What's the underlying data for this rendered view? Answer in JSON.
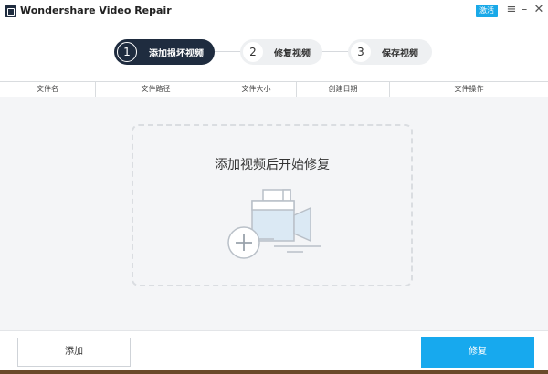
{
  "window": {
    "title": "Wondershare Video Repair",
    "activate_label": "激活",
    "icons": [
      "menu-icon",
      "minimize-icon",
      "close-icon"
    ]
  },
  "steps": [
    {
      "number": "1",
      "label": "添加损坏视频",
      "active": true
    },
    {
      "number": "2",
      "label": "修复视频",
      "active": false
    },
    {
      "number": "3",
      "label": "保存视频",
      "active": false
    }
  ],
  "table": {
    "columns": [
      "文件名",
      "文件路径",
      "文件大小",
      "创建日期",
      "文件操作"
    ]
  },
  "dropzone": {
    "title": "添加视频后开始修复",
    "icon": "add-video-icon"
  },
  "footer": {
    "add_label": "添加",
    "repair_label": "修复"
  },
  "colors": {
    "accent": "#17a9ee",
    "step_active": "#1f2c3f"
  }
}
